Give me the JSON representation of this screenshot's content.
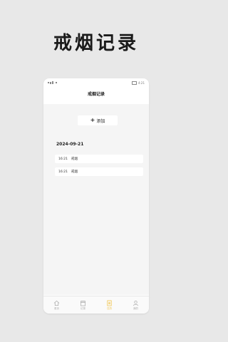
{
  "promo": {
    "title": "戒烟记录"
  },
  "statusbar": {
    "time": "4:21"
  },
  "navbar": {
    "title": "戒烟记录"
  },
  "toolbar": {
    "add_label": "添加",
    "add_symbol": "+"
  },
  "records": {
    "date": "2024-09-21",
    "items": [
      {
        "time": "16:21",
        "label": "戒烟"
      },
      {
        "time": "16:21",
        "label": "戒烟"
      }
    ]
  },
  "tabs": [
    {
      "label": "首页",
      "icon": "home-icon"
    },
    {
      "label": "记录",
      "icon": "calendar-icon"
    },
    {
      "label": "日历",
      "icon": "list-icon",
      "active": true
    },
    {
      "label": "我的",
      "icon": "user-icon"
    }
  ],
  "colors": {
    "accent": "#f0c040",
    "background": "#e8e8e8",
    "content_bg": "#f5f5f5"
  }
}
